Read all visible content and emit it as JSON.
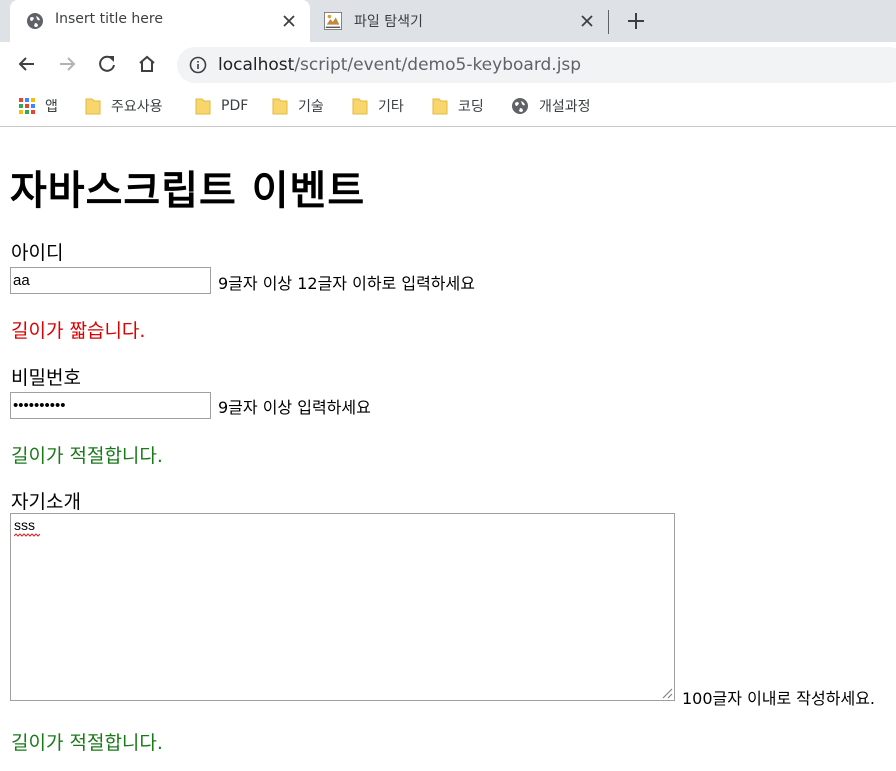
{
  "browser": {
    "tabs": [
      {
        "title": "Insert title here",
        "favicon": "globe-icon"
      },
      {
        "title": "파일 탐색기",
        "favicon": "file-explorer-icon"
      }
    ],
    "url_host": "localhost",
    "url_path": "/script/event/demo5-keyboard.jsp",
    "bookmarks": [
      {
        "label": "앱",
        "icon": "apps-grid-icon"
      },
      {
        "label": "주요사용",
        "icon": "folder-icon"
      },
      {
        "label": "PDF",
        "icon": "folder-icon"
      },
      {
        "label": "기술",
        "icon": "folder-icon"
      },
      {
        "label": "기타",
        "icon": "folder-icon"
      },
      {
        "label": "코딩",
        "icon": "folder-icon"
      },
      {
        "label": "개설과정",
        "icon": "globe-icon"
      }
    ]
  },
  "page": {
    "title": "자바스크립트 이벤트",
    "id_field": {
      "label": "아이디",
      "value": "aa",
      "hint": "9글자 이상 12글자 이하로 입력하세요",
      "message": "길이가 짧습니다."
    },
    "password_field": {
      "label": "비밀번호",
      "value": "••••••••••",
      "hint": "9글자 이상 입력하세요",
      "message": "길이가 적절합니다."
    },
    "intro_field": {
      "label": "자기소개",
      "value": "sss",
      "hint": "100글자 이내로 작성하세요.",
      "message": "길이가 적절합니다."
    }
  },
  "colors": {
    "error": "#dd0000",
    "ok": "#1a7a1a",
    "tabbar": "#dee1e6",
    "omnibox": "#f1f3f4"
  }
}
